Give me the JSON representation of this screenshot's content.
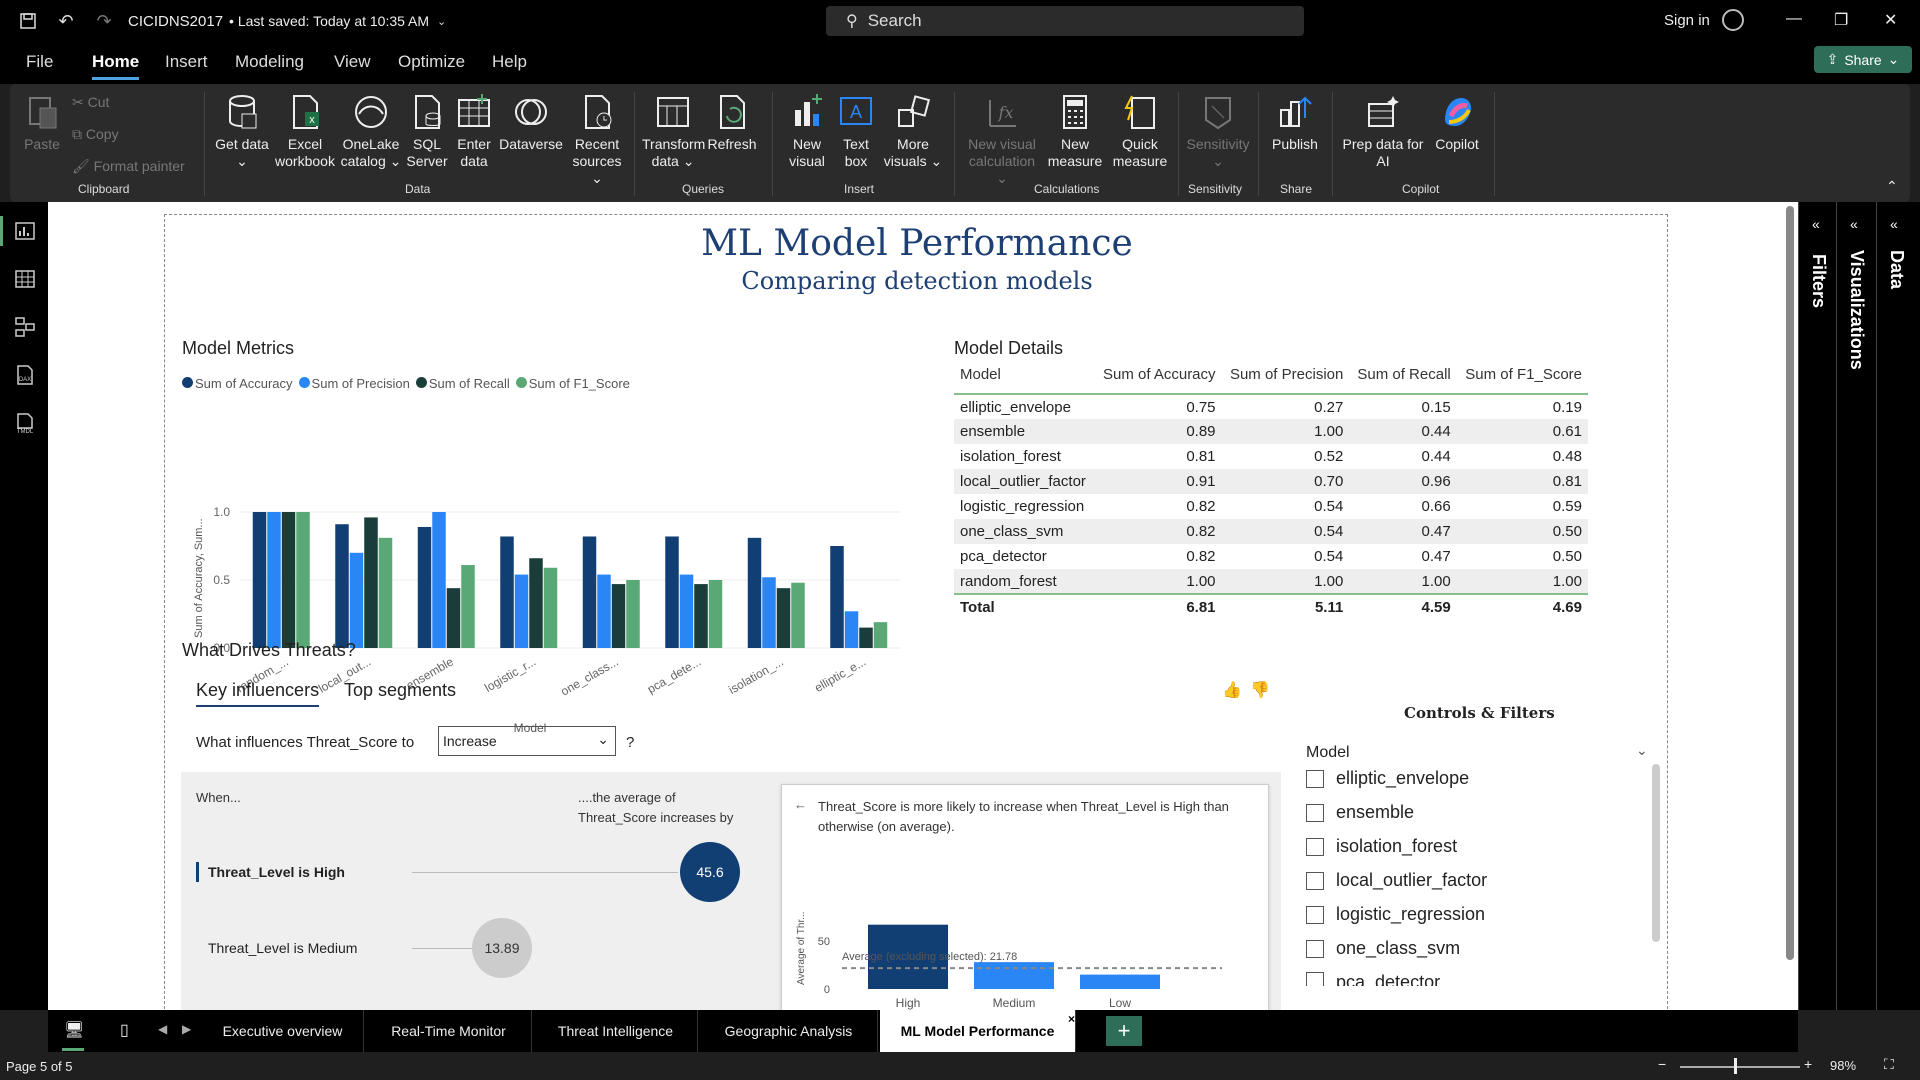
{
  "titlebar": {
    "file_title": "CICIDNS2017",
    "saved": "• Last saved: Today at 10:35 AM",
    "search_placeholder": "Search",
    "signin": "Sign in"
  },
  "menu": {
    "items": [
      "File",
      "Home",
      "Insert",
      "Modeling",
      "View",
      "Optimize",
      "Help"
    ],
    "active": "Home",
    "share": "Share"
  },
  "ribbon": {
    "clipboard": {
      "paste": "Paste",
      "cut": "Cut",
      "copy": "Copy",
      "format_painter": "Format painter",
      "label": "Clipboard"
    },
    "data": {
      "get_data": "Get data ⌄",
      "excel": "Excel workbook",
      "onelake": "OneLake catalog ⌄",
      "sql": "SQL Server",
      "enter": "Enter data",
      "dataverse": "Dataverse",
      "recent": "Recent sources ⌄",
      "label": "Data"
    },
    "queries": {
      "transform": "Transform data ⌄",
      "refresh": "Refresh",
      "label": "Queries"
    },
    "insert": {
      "new_visual": "New visual",
      "text_box": "Text box",
      "more_visuals": "More visuals ⌄",
      "label": "Insert"
    },
    "calculations": {
      "new_visual_calc": "New visual calculation ⌄",
      "new_measure": "New measure",
      "quick_measure": "Quick measure",
      "label": "Calculations"
    },
    "sensitivity": {
      "sensitivity": "Sensitivity ⌄",
      "label": "Sensitivity"
    },
    "share": {
      "publish": "Publish",
      "label": "Share"
    },
    "copilot": {
      "prep": "Prep data for AI",
      "copilot": "Copilot",
      "label": "Copilot"
    }
  },
  "report": {
    "title": "ML Model Performance",
    "subtitle": "Comparing detection models",
    "metrics_title": "Model Metrics",
    "details_title": "Model Details",
    "drives_title": "What Drives Threats?"
  },
  "colors": {
    "accuracy": "#123f73",
    "precision": "#2a86f5",
    "recall": "#1a3d39",
    "f1": "#5aa876"
  },
  "chart_data": {
    "type": "bar",
    "categories": [
      "random_...",
      "local_out...",
      "ensemble",
      "logistic_r...",
      "one_class...",
      "pca_dete...",
      "isolation_...",
      "elliptic_e..."
    ],
    "series": [
      {
        "name": "Sum of Accuracy",
        "values": [
          1.0,
          0.91,
          0.89,
          0.82,
          0.82,
          0.82,
          0.81,
          0.75
        ]
      },
      {
        "name": "Sum of Precision",
        "values": [
          1.0,
          0.7,
          1.0,
          0.54,
          0.54,
          0.54,
          0.52,
          0.27
        ]
      },
      {
        "name": "Sum of Recall",
        "values": [
          1.0,
          0.96,
          0.44,
          0.66,
          0.47,
          0.47,
          0.44,
          0.15
        ]
      },
      {
        "name": "Sum of F1_Score",
        "values": [
          1.0,
          0.81,
          0.61,
          0.59,
          0.5,
          0.5,
          0.48,
          0.19
        ]
      }
    ],
    "yticks": [
      "1.0",
      "0.5",
      "0.0"
    ],
    "ylim": [
      0,
      1.0
    ],
    "xlabel": "Model",
    "ylabel": "Sum of Accuracy, Sum...",
    "legend": "top-left"
  },
  "table": {
    "headers": [
      "Model",
      "Sum of Accuracy",
      "Sum of Precision",
      "Sum of Recall",
      "Sum of F1_Score"
    ],
    "rows": [
      [
        "elliptic_envelope",
        "0.75",
        "0.27",
        "0.15",
        "0.19"
      ],
      [
        "ensemble",
        "0.89",
        "1.00",
        "0.44",
        "0.61"
      ],
      [
        "isolation_forest",
        "0.81",
        "0.52",
        "0.44",
        "0.48"
      ],
      [
        "local_outlier_factor",
        "0.91",
        "0.70",
        "0.96",
        "0.81"
      ],
      [
        "logistic_regression",
        "0.82",
        "0.54",
        "0.66",
        "0.59"
      ],
      [
        "one_class_svm",
        "0.82",
        "0.54",
        "0.47",
        "0.50"
      ],
      [
        "pca_detector",
        "0.82",
        "0.54",
        "0.47",
        "0.50"
      ],
      [
        "random_forest",
        "1.00",
        "1.00",
        "1.00",
        "1.00"
      ]
    ],
    "total": [
      "Total",
      "6.81",
      "5.11",
      "4.59",
      "4.69"
    ]
  },
  "key_influencers": {
    "tab_key": "Key influencers",
    "tab_top": "Top segments",
    "question": "What influences Threat_Score to",
    "select_value": "Increase",
    "qmark": "?",
    "when": "When...",
    "increase_label_1": "....the average of",
    "increase_label_2": "Threat_Score increases by",
    "item1": "Threat_Level is High",
    "item1_value": "45.6",
    "item2": "Threat_Level is Medium",
    "item2_value": "13.89",
    "detail_text": "Threat_Score is more likely to increase when Threat_Level is High than otherwise (on average).",
    "detail_ylabel": "Average of Thr...",
    "detail_avg": "Average (excluding selected): 21.78",
    "detail_yticks": [
      "50",
      "0"
    ],
    "detail_bars": [
      {
        "label": "High",
        "value": 67
      },
      {
        "label": "Medium",
        "value": 28
      },
      {
        "label": "Low",
        "value": 15
      }
    ]
  },
  "slicer": {
    "title": "Controls & Filters",
    "header": "Model",
    "items": [
      "elliptic_envelope",
      "ensemble",
      "isolation_forest",
      "local_outlier_factor",
      "logistic_regression",
      "one_class_svm",
      "pca_detector"
    ]
  },
  "panes": {
    "filters": "Filters",
    "visualizations": "Visualizations",
    "data": "Data"
  },
  "pages": {
    "tabs": [
      "Executive overview",
      "Real-Time Monitor",
      "Threat Intelligence",
      "Geographic Analysis",
      "ML Model Performance"
    ],
    "active": "ML Model Performance",
    "status": "Page 5 of 5",
    "zoom": "98%"
  }
}
